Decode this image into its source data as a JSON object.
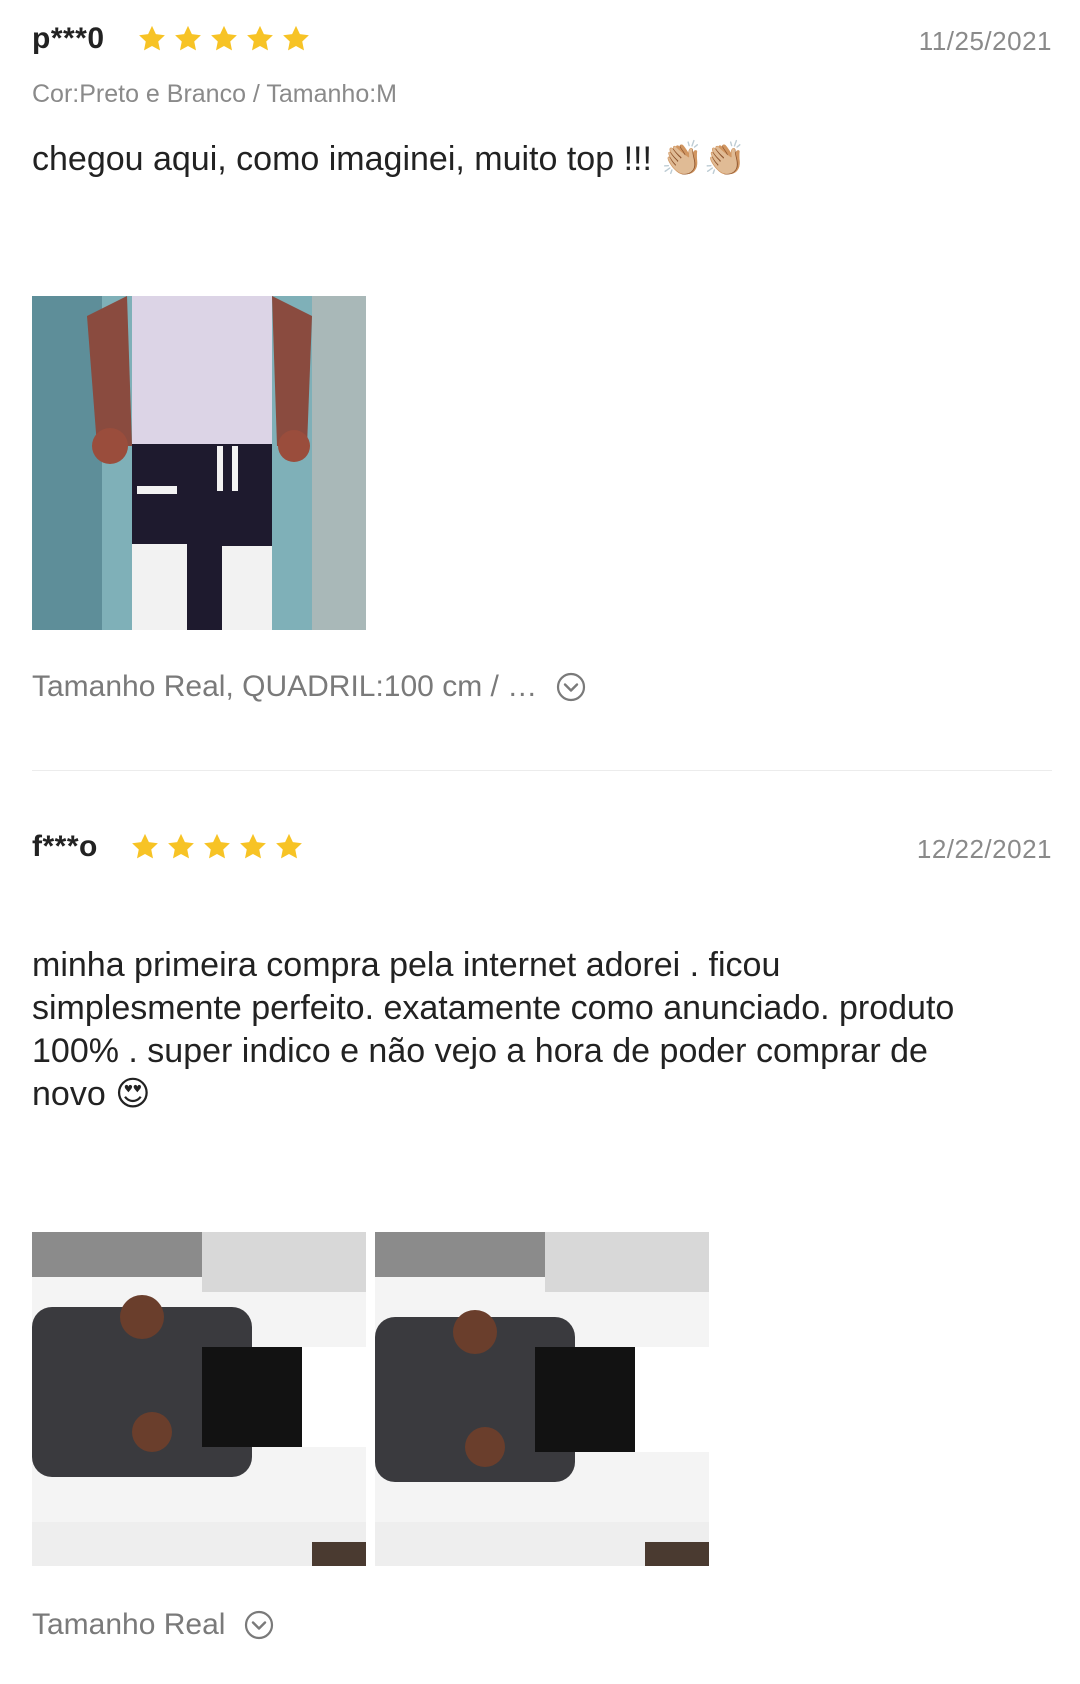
{
  "reviews": [
    {
      "username": "p***0",
      "rating": 5,
      "date": "11/25/2021",
      "variant": "Cor:Preto e Branco / Tamanho:M",
      "comment": "chegou aqui, como imaginei, muito top !!! 👏🏼👏🏼",
      "photos": [
        "photo-man-white-tank-top-black-white-pants"
      ],
      "size_info": "Tamanho Real, QUADRIL:100 cm / …"
    },
    {
      "username": "f***o",
      "rating": 5,
      "date": "12/22/2021",
      "comment": "minha primeira compra pela internet adorei . ficou simplesmente perfeito.  exatamente como anunciado. produto 100% . super indico e não vejo a hora de poder comprar de novo 😍",
      "photos": [
        "photo-man-rotated-black-white-pants-1",
        "photo-man-rotated-black-white-pants-2"
      ],
      "size_info": "Tamanho Real"
    }
  ],
  "colors": {
    "star": "#f7c325",
    "muted": "#8a8a8a",
    "text": "#222222"
  },
  "icons": {
    "star": "star-icon",
    "expand": "chevron-down-circle-icon"
  }
}
